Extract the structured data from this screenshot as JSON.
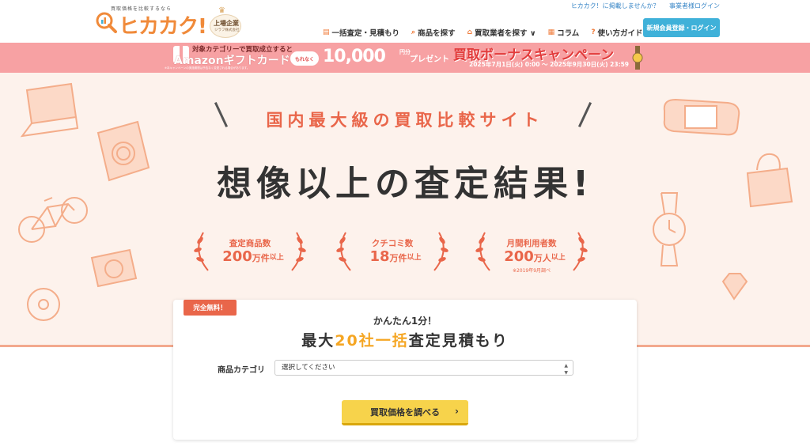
{
  "header": {
    "logo_tagline": "買取価格を比較するなら",
    "logo_text": "ヒカカク!",
    "listed_badge_title": "上場企業",
    "listed_badge_sub": "ジラフ株式会社",
    "top_links": [
      "ヒカカク！に掲載しませんか？",
      "事業者様ログイン"
    ],
    "nav": [
      {
        "icon": "calculator-icon",
        "label": "一括査定・見積もり"
      },
      {
        "icon": "search-icon",
        "label": "商品を探す"
      },
      {
        "icon": "shop-icon",
        "label": "買取業者を探す ∨"
      },
      {
        "icon": "column-icon",
        "label": "コラム"
      },
      {
        "icon": "question-icon",
        "label": "使い方ガイド"
      }
    ],
    "register_button": "新規会員登録・ログイン"
  },
  "banner": {
    "line1": "対象カテゴリーで買取成立すると",
    "line2": "Amazonギフトカード",
    "pill": "もれなく",
    "amount": "10,000",
    "unit": "円分",
    "present": "プレゼント",
    "campaign": "買取ボーナスキャンペーン",
    "period": "2025年7月1日(火) 0:00 ～ 2025年9月30日(火) 23:59",
    "note": "※本キャンペーンの実施期間は予告なく変更される場合があります。"
  },
  "hero": {
    "subtitle": "国内最大級の買取比較サイト",
    "headline": "想像以上の査定結果!",
    "stats": [
      {
        "label": "査定商品数",
        "value": "200",
        "unit": "万件",
        "suffix": "以上",
        "note": ""
      },
      {
        "label": "クチコミ数",
        "value": "18",
        "unit": "万件",
        "suffix": "以上",
        "note": ""
      },
      {
        "label": "月間利用者数",
        "value": "200",
        "unit": "万人",
        "suffix": "以上",
        "note": "※2019年9月調べ"
      }
    ]
  },
  "form": {
    "free_tag": "完全無料！",
    "subtitle": "かんたん1分！",
    "title_pre": "最大",
    "title_highlight": "20社一括",
    "title_post": "査定見積もり",
    "category_label": "商品カテゴリ",
    "category_select_value": "選択してください",
    "submit_button": "買取価格を調べる"
  },
  "colors": {
    "accent_orange": "#e9664a",
    "banner_pink": "#f7a1a3",
    "register_blue": "#3fb1d9",
    "cta_yellow": "#f7d34b",
    "hero_bg": "#fdf2ec"
  }
}
